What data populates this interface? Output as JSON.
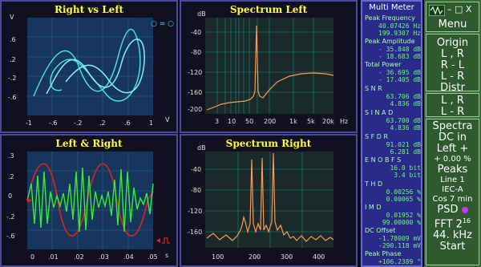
{
  "panels": {
    "xy": {
      "title": "Right vs Left",
      "y_axis": "V",
      "x_axis": "V",
      "ticks_x": [
        "-1",
        "-.6",
        "-.2",
        ".2",
        ".6",
        "1"
      ],
      "legend": "○ = ○"
    },
    "spec_left": {
      "title": "Spectrum Left",
      "unit": "dB",
      "ticks_y": [
        "-40",
        "-80",
        "-120",
        "-160",
        "-200"
      ],
      "ticks_x": [
        "3",
        "10",
        "50",
        "200",
        "1k",
        "5k",
        "20k"
      ],
      "x_unit": "Hz"
    },
    "time": {
      "title": "Left & Right",
      "ticks_x": [
        "0",
        ".01",
        ".02",
        ".03",
        ".04",
        ".05"
      ],
      "x_unit": "s"
    },
    "spec_right": {
      "title": "Spectrum Right",
      "unit": "dB",
      "ticks_y": [
        "-40",
        "-80",
        "-120",
        "-160"
      ],
      "ticks_x": [
        "100",
        "200",
        "300",
        "400"
      ]
    }
  },
  "meter": {
    "title": "Multi Meter",
    "peak_freq_label": "Peak Frequency",
    "peak_freq_1": "40.07426 Hz",
    "peak_freq_2": "199.9307 Hz",
    "peak_amp_label": "Peak Amplitude",
    "peak_amp_1": "- 35.848 dB",
    "peak_amp_2": "- 18.683 dB",
    "total_power_label": "Total Power",
    "total_power_1": "- 36.695 dB",
    "total_power_2": "- 17.405 dB",
    "snr_label": "S N R",
    "snr_1": "63.706 dB",
    "snr_2": "4.836 dB",
    "sinad_label": "S I N A D",
    "sinad_1": "63.700 dB",
    "sinad_2": "4.836 dB",
    "sfdr_label": "S F D R",
    "sfdr_1": "91.021 dB",
    "sfdr_2": "6.281 dB",
    "enob_label": "E N O B   F S",
    "enob_1": "16.0 bit",
    "enob_2": "3.4 bit",
    "thd_label": "T H D",
    "thd_1": "0.00256 %",
    "thd_2": "0.00065 %",
    "imd_label": "I M D",
    "imd_1": "0.01952 %",
    "imd_2": "99.00000 %",
    "dc_label": "DC Offset",
    "dc_1": "-1.78009 mV",
    "dc_2": "-290.118 mV",
    "phase_label": "Peak Phase",
    "phase_1": "+106.2389 °"
  },
  "controls": {
    "window_buttons": "– □ X",
    "menu": "Menu",
    "origin": [
      "Origin",
      "L , R",
      "R - L",
      "L - R",
      "Distr"
    ],
    "lr": [
      "L , R",
      "L - R"
    ],
    "spectra": [
      "Spectra",
      "DC in",
      "Left +",
      "+ 0.00 %",
      "Peaks",
      "Line  1",
      "IEC-A",
      "Cos 7 min",
      "PSD",
      "FFT 2",
      "16",
      "44. kHz",
      "Start"
    ]
  },
  "colors": {
    "trace_cyan": "#44ddee",
    "trace_red": "#dd2222",
    "trace_green": "#33ee33",
    "trace_orange": "#ff9955",
    "grid": "#1e8a7a",
    "title": "#ffff33"
  }
}
